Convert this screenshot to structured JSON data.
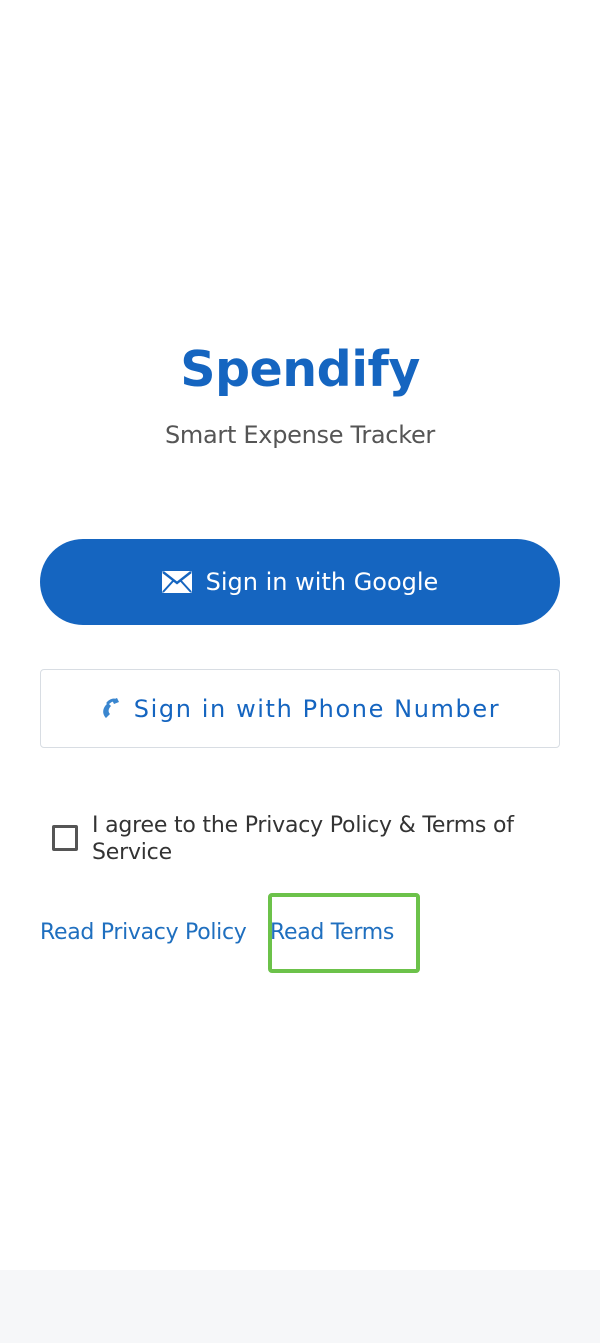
{
  "header": {
    "title": "Spendify",
    "subtitle": "Smart Expense Tracker"
  },
  "auth": {
    "google_label": "Sign in with Google",
    "google_icon": "mail-icon",
    "phone_label": "Sign in with Phone Number",
    "phone_icon": "phone-icon"
  },
  "consent": {
    "checked": false,
    "text": "I agree to the Privacy Policy & Terms of Service"
  },
  "links": {
    "privacy": "Read Privacy Policy",
    "terms": "Read Terms"
  },
  "colors": {
    "brand": "#1565c0",
    "highlight": "#6cc24a"
  }
}
